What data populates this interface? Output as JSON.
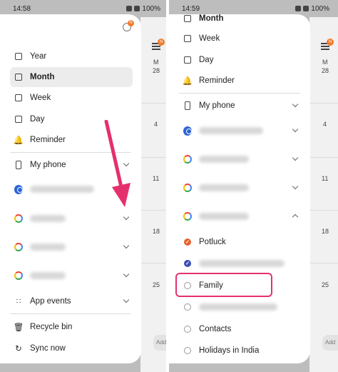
{
  "left": {
    "status": {
      "time": "14:58",
      "battery": "100%"
    },
    "badge": "N",
    "calendar_days": [
      "M",
      "28",
      "4",
      "11",
      "18",
      "25"
    ],
    "add_label": "Add",
    "views": [
      {
        "label": "Year",
        "icon": "calendar-icon"
      },
      {
        "label": "Month",
        "icon": "calendar-icon",
        "selected": true
      },
      {
        "label": "Week",
        "icon": "calendar-icon"
      },
      {
        "label": "Day",
        "icon": "calendar-icon"
      },
      {
        "label": "Reminder",
        "icon": "bell-icon"
      }
    ],
    "my_phone": "My phone",
    "app_events": "App events",
    "recycle_bin": "Recycle bin",
    "sync_now": "Sync now"
  },
  "right": {
    "status": {
      "time": "14:59",
      "battery": "100%"
    },
    "badge": "N",
    "calendar_days": [
      "M",
      "28",
      "4",
      "11",
      "18",
      "25"
    ],
    "add_label": "Add",
    "views": [
      {
        "label": "Month",
        "icon": "calendar-icon"
      },
      {
        "label": "Week",
        "icon": "calendar-icon"
      },
      {
        "label": "Day",
        "icon": "calendar-icon"
      },
      {
        "label": "Reminder",
        "icon": "bell-icon"
      }
    ],
    "my_phone": "My phone",
    "calendars": [
      {
        "label": "Potluck",
        "state": "checked",
        "color": "#e8612c"
      },
      {
        "label": "",
        "state": "checked",
        "color": "#3b4fb8",
        "blurred": true
      },
      {
        "label": "Family",
        "state": "unchecked",
        "highlighted": true
      },
      {
        "label": "",
        "state": "unchecked",
        "blurred": true
      },
      {
        "label": "Contacts",
        "state": "unchecked"
      },
      {
        "label": "Holidays in India",
        "state": "unchecked"
      }
    ]
  },
  "colors": {
    "accent": "#f07a2a",
    "arrow": "#e5306e",
    "highlight": "#e5306e"
  }
}
